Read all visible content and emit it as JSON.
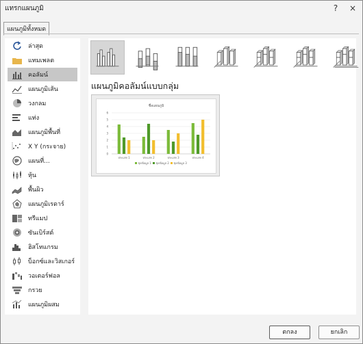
{
  "window": {
    "title": "แทรกแผนภูมิ",
    "help_label": "?",
    "close_label": "×"
  },
  "tabs": [
    {
      "label": "แผนภูมิทั้งหมด"
    }
  ],
  "sidebar": {
    "items": [
      {
        "label": "ล่าสุด",
        "icon": "recent-icon"
      },
      {
        "label": "แทมเพลต",
        "icon": "templates-folder-icon"
      },
      {
        "label": "คอลัมน์",
        "icon": "column-chart-icon",
        "selected": true
      },
      {
        "label": "แผนภูมิเส้น",
        "icon": "line-chart-icon"
      },
      {
        "label": "วงกลม",
        "icon": "pie-chart-icon"
      },
      {
        "label": "แท่ง",
        "icon": "bar-chart-icon"
      },
      {
        "label": "แผนภูมิพื้นที่",
        "icon": "area-chart-icon"
      },
      {
        "label": "X Y (กระจาย)",
        "icon": "scatter-chart-icon"
      },
      {
        "label": "แผนที่...",
        "icon": "map-chart-icon"
      },
      {
        "label": "หุ้น",
        "icon": "stock-chart-icon"
      },
      {
        "label": "พื้นผิว",
        "icon": "surface-chart-icon"
      },
      {
        "label": "แผนภูมิเรดาร์",
        "icon": "radar-chart-icon"
      },
      {
        "label": "ทรีแมป",
        "icon": "treemap-icon"
      },
      {
        "label": "ซันเบิร์สต์",
        "icon": "sunburst-icon"
      },
      {
        "label": "ฮิสโทแกรม",
        "icon": "histogram-icon"
      },
      {
        "label": "บ็อกซ์และวิสเกอร์",
        "icon": "box-whisker-icon"
      },
      {
        "label": "วอเตอร์ฟอล",
        "icon": "waterfall-icon"
      },
      {
        "label": "กรวย",
        "icon": "funnel-icon"
      },
      {
        "label": "แผนภูมิผสม",
        "icon": "combo-chart-icon"
      }
    ]
  },
  "subtypes": [
    {
      "icon": "clustered-column-icon",
      "selected": true
    },
    {
      "icon": "stacked-column-icon"
    },
    {
      "icon": "100-stacked-column-icon"
    },
    {
      "icon": "3d-clustered-column-icon"
    },
    {
      "icon": "3d-stacked-column-icon"
    },
    {
      "icon": "3d-100-stacked-column-icon"
    },
    {
      "icon": "3d-column-icon"
    }
  ],
  "heading": "แผนภูมิคอลัมน์แบบกลุ่ม",
  "chart_data": {
    "type": "bar",
    "title": "ชื่อแผนภูมิ",
    "categories": [
      "ประเภท 1",
      "ประเภท 2",
      "ประเภท 3",
      "ประเภท 4"
    ],
    "series": [
      {
        "name": "ชุดข้อมูล 1",
        "values": [
          4.3,
          2.5,
          3.5,
          4.5
        ],
        "color": "#7cbb3a"
      },
      {
        "name": "ชุดข้อมูล 2",
        "values": [
          2.4,
          4.4,
          1.8,
          2.8
        ],
        "color": "#4f9a2a"
      },
      {
        "name": "ชุดข้อมูล 3",
        "values": [
          2.0,
          2.0,
          3.0,
          5.0
        ],
        "color": "#f2be2e"
      }
    ],
    "ylim": [
      0,
      6
    ],
    "yticks": [
      0,
      1,
      2,
      3,
      4,
      5,
      6
    ],
    "grid": true,
    "legend": "bottom"
  },
  "buttons": {
    "ok_label": "ตกลง",
    "cancel_label": "ยกเลิก"
  },
  "colors": {
    "accent": "#7cbb3a",
    "selection": "#c7c7c7"
  }
}
